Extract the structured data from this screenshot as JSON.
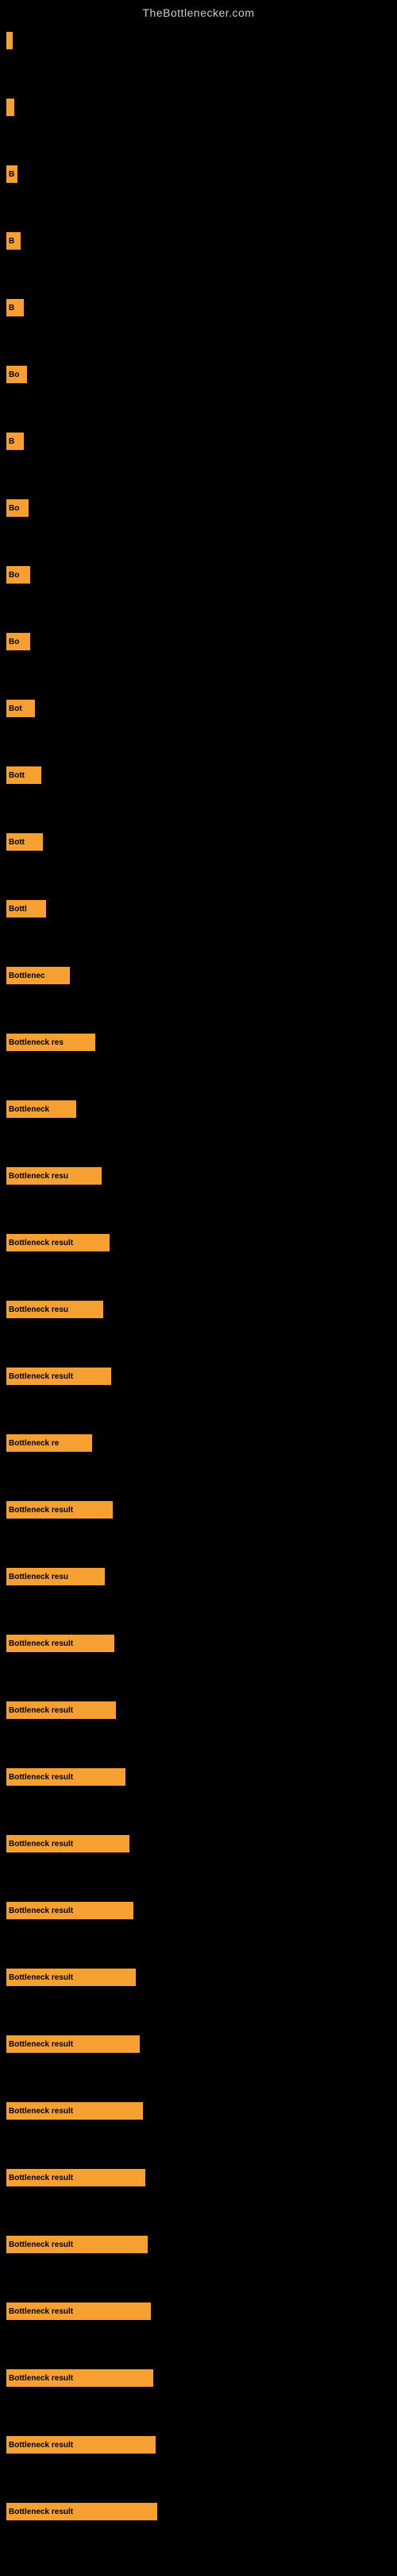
{
  "site": {
    "title": "TheBottlenecker.com"
  },
  "bars": [
    {
      "label": "",
      "width": 8
    },
    {
      "label": "",
      "width": 10
    },
    {
      "label": "B",
      "width": 14
    },
    {
      "label": "B",
      "width": 18
    },
    {
      "label": "B",
      "width": 22
    },
    {
      "label": "Bo",
      "width": 26
    },
    {
      "label": "B",
      "width": 22
    },
    {
      "label": "Bo",
      "width": 28
    },
    {
      "label": "Bo",
      "width": 30
    },
    {
      "label": "Bo",
      "width": 30
    },
    {
      "label": "Bot",
      "width": 36
    },
    {
      "label": "Bott",
      "width": 44
    },
    {
      "label": "Bott",
      "width": 46
    },
    {
      "label": "Bottl",
      "width": 50
    },
    {
      "label": "Bottlenec",
      "width": 80
    },
    {
      "label": "Bottleneck res",
      "width": 112
    },
    {
      "label": "Bottleneck",
      "width": 88
    },
    {
      "label": "Bottleneck resu",
      "width": 120
    },
    {
      "label": "Bottleneck result",
      "width": 130
    },
    {
      "label": "Bottleneck resu",
      "width": 122
    },
    {
      "label": "Bottleneck result",
      "width": 132
    },
    {
      "label": "Bottleneck re",
      "width": 108
    },
    {
      "label": "Bottleneck result",
      "width": 134
    },
    {
      "label": "Bottleneck resu",
      "width": 124
    },
    {
      "label": "Bottleneck result",
      "width": 136
    },
    {
      "label": "Bottleneck result",
      "width": 138
    },
    {
      "label": "Bottleneck result",
      "width": 150
    },
    {
      "label": "Bottleneck result",
      "width": 155
    },
    {
      "label": "Bottleneck result",
      "width": 160
    },
    {
      "label": "Bottleneck result",
      "width": 163
    },
    {
      "label": "Bottleneck result",
      "width": 168
    },
    {
      "label": "Bottleneck result",
      "width": 172
    },
    {
      "label": "Bottleneck result",
      "width": 175
    },
    {
      "label": "Bottleneck result",
      "width": 178
    },
    {
      "label": "Bottleneck result",
      "width": 182
    },
    {
      "label": "Bottleneck result",
      "width": 185
    },
    {
      "label": "Bottleneck result",
      "width": 188
    },
    {
      "label": "Bottleneck result",
      "width": 190
    }
  ]
}
